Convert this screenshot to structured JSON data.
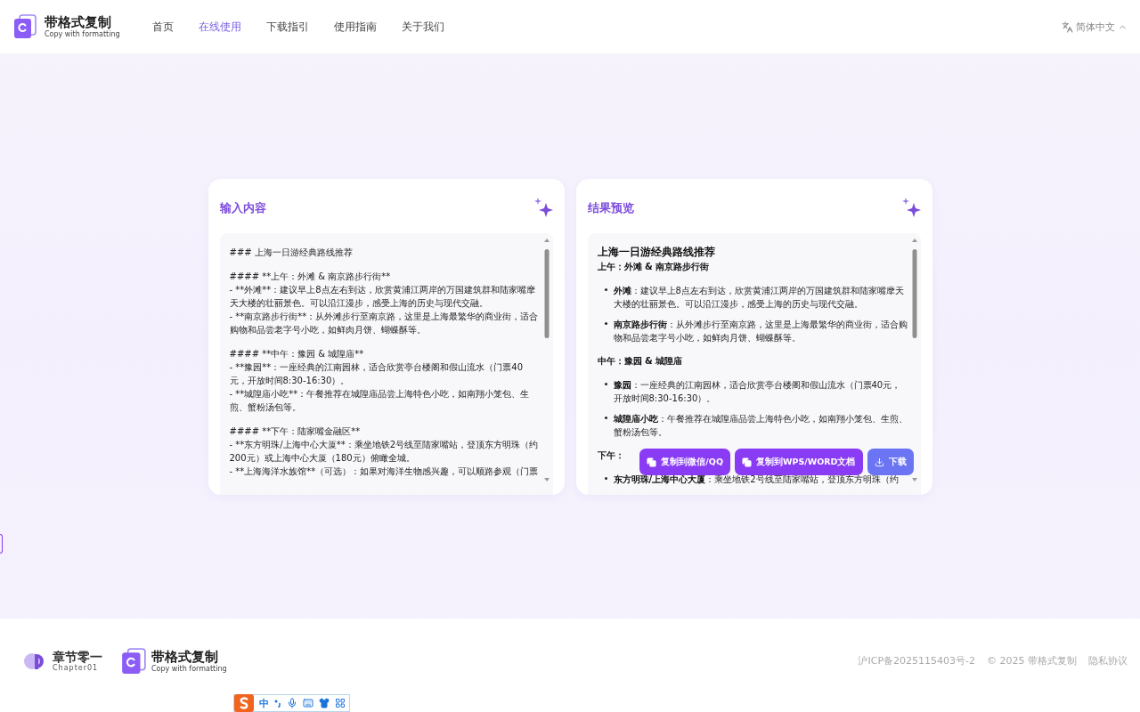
{
  "brand": {
    "name": "带格式复制",
    "subtitle": "Copy with formatting"
  },
  "nav": [
    {
      "label": "首页",
      "selected": false
    },
    {
      "label": "在线使用",
      "selected": true
    },
    {
      "label": "下载指引",
      "selected": false
    },
    {
      "label": "使用指南",
      "selected": false
    },
    {
      "label": "关于我们",
      "selected": false
    }
  ],
  "language": {
    "label": "简体中文"
  },
  "input_panel": {
    "title": "输入内容",
    "blocks": [
      [
        "### 上海一日游经典路线推荐"
      ],
      [
        "#### **上午：外滩 & 南京路步行街**",
        "- **外滩**：建议早上8点左右到达，欣赏黄浦江两岸的万国建筑群和陆家嘴摩天大楼的壮丽景色。可以沿江漫步，感受上海的历史与现代交融。",
        "- **南京路步行街**：从外滩步行至南京路，这里是上海最繁华的商业街，适合购物和品尝老字号小吃，如鲜肉月饼、蝴蝶酥等。"
      ],
      [
        "#### **中午：豫园 & 城隍庙**",
        "- **豫园**：一座经典的江南园林，适合欣赏亭台楼阁和假山流水（门票40元，开放时间8:30-16:30）。",
        "- **城隍庙小吃**：午餐推荐在城隍庙品尝上海特色小吃，如南翔小笼包、生煎、蟹粉汤包等。"
      ],
      [
        "#### **下午：陆家嘴金融区**",
        "- **东方明珠/上海中心大厦**：乘坐地铁2号线至陆家嘴站，登顶东方明珠（约200元）或上海中心大厦（180元）俯瞰全城。",
        "- **上海海洋水族馆**（可选）：如果对海洋生物感兴趣，可以顺路参观（门票"
      ]
    ]
  },
  "preview_panel": {
    "title": "结果预览",
    "heading": "上海一日游经典路线推荐",
    "sections": [
      {
        "heading": "上午：外滩 & 南京路步行街",
        "items": [
          "**外滩**：建议早上8点左右到达，欣赏黄浦江两岸的万国建筑群和陆家嘴摩天大楼的壮丽景色。可以沿江漫步，感受上海的历史与现代交融。",
          "**南京路步行街**：从外滩步行至南京路，这里是上海最繁华的商业街，适合购物和品尝老字号小吃，如鲜肉月饼、蝴蝶酥等。"
        ]
      },
      {
        "heading": "中午：豫园 & 城隍庙",
        "items": [
          "**豫园**：一座经典的江南园林，适合欣赏亭台楼阁和假山流水（门票40元，开放时间8:30-16:30）。",
          "**城隍庙小吃**：午餐推荐在城隍庙品尝上海特色小吃，如南翔小笼包、生煎、蟹粉汤包等。"
        ]
      },
      {
        "heading": "下午：",
        "items": [
          "**东方明珠/上海中心大厦**：乘坐地铁2号线至陆家嘴站，登顶东方明珠（约"
        ]
      }
    ]
  },
  "actions": [
    {
      "label": "复制到微信/QQ",
      "kind": "copy"
    },
    {
      "label": "复制到WPS/WORD文档",
      "kind": "copy"
    },
    {
      "label": "下载",
      "kind": "download"
    }
  ],
  "footer": {
    "partner_name": "章节零一",
    "partner_subtitle": "Chapter01",
    "brand_name": "带格式复制",
    "brand_subtitle": "Copy with formatting",
    "icp": "沪ICP备2025115403号-2",
    "copyright": "© 2025 带格式复制",
    "privacy": "隐私协议"
  },
  "ime_bar": {
    "mode": "中"
  }
}
